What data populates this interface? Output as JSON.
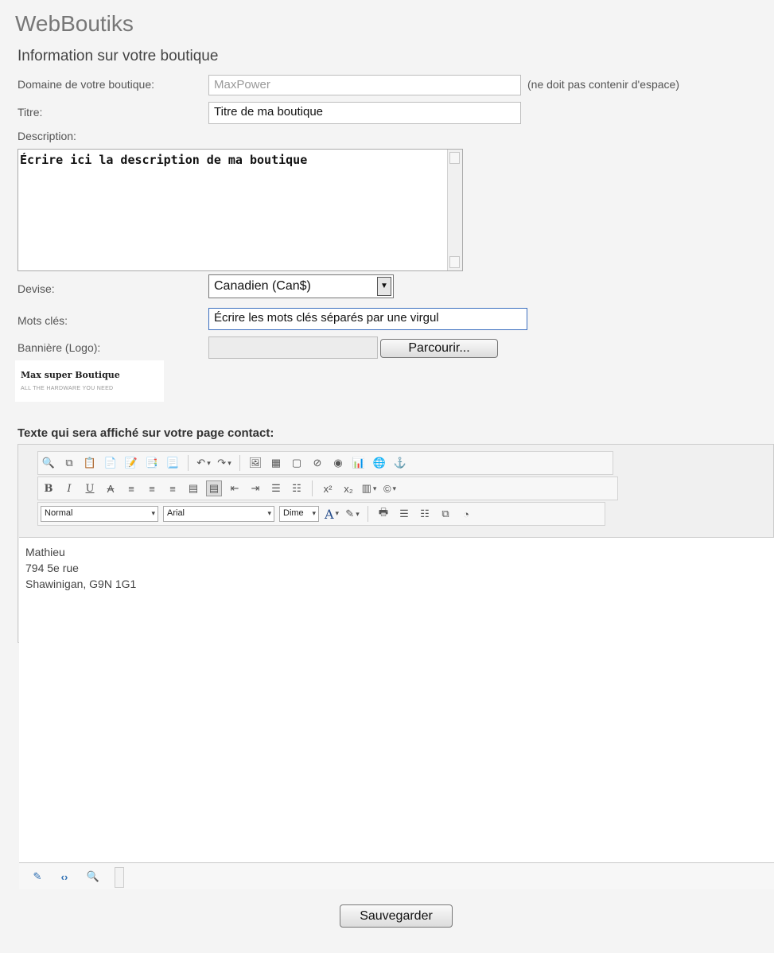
{
  "app": {
    "site_title": "WebBoutiks",
    "section_title": "Information sur votre boutique"
  },
  "form": {
    "domain": {
      "label": "Domaine de votre boutique:",
      "placeholder": "MaxPower",
      "note": "(ne doit pas contenir d'espace)"
    },
    "title": {
      "label": "Titre:",
      "value": "Titre de ma boutique"
    },
    "description": {
      "label": "Description:",
      "value": "Écrire ici la description de ma boutique"
    },
    "currency": {
      "label": "Devise:",
      "selected": "Canadien (Can$)"
    },
    "keywords": {
      "label": "Mots clés:",
      "value": "Écrire les mots clés séparés par une virgul"
    },
    "banner": {
      "label": "Bannière (Logo):",
      "browse_label": "Parcourir..."
    },
    "logo": {
      "line1": "Max super Boutique",
      "line2": "ALL THE HARDWARE YOU NEED"
    },
    "contact": {
      "label": "Texte qui sera affiché sur votre page contact:",
      "lines": [
        "Mathieu",
        "794 5e rue",
        "Shawinigan, G9N 1G1"
      ]
    }
  },
  "editor": {
    "format_value": "Normal",
    "font_value": "Arial",
    "size_value": "Dime",
    "row1_icons": [
      "find-icon",
      "copy-icon",
      "paste-icon",
      "paste-text-icon",
      "paste-word-icon",
      "paste-html-icon",
      "paste-special-icon",
      "undo-icon",
      "redo-icon",
      "image-icon",
      "table-icon",
      "media-icon",
      "flash-icon",
      "special-char-icon",
      "chart-icon",
      "hyperlink-icon",
      "anchor-icon"
    ],
    "row2_icons": [
      "bold-icon",
      "italic-icon",
      "underline-icon",
      "strikethrough-icon",
      "align-left-icon",
      "align-center-icon",
      "align-right-icon",
      "justify-icon",
      "justify-full-icon",
      "outdent-icon",
      "indent-icon",
      "numbered-list-icon",
      "bullet-list-icon",
      "superscript-icon",
      "subscript-icon",
      "table-props-icon",
      "symbol-icon"
    ],
    "row3_icons": [
      "font-color-icon",
      "highlight-icon",
      "print-icon",
      "insert-rows-icon",
      "insert-cols-icon",
      "paste-column-icon",
      "time-icon"
    ]
  },
  "save_label": "Sauvegarder",
  "colors": {
    "page_bg": "#f4f4f4",
    "title_gray": "#777777",
    "input_border": "#bdbdbd"
  }
}
